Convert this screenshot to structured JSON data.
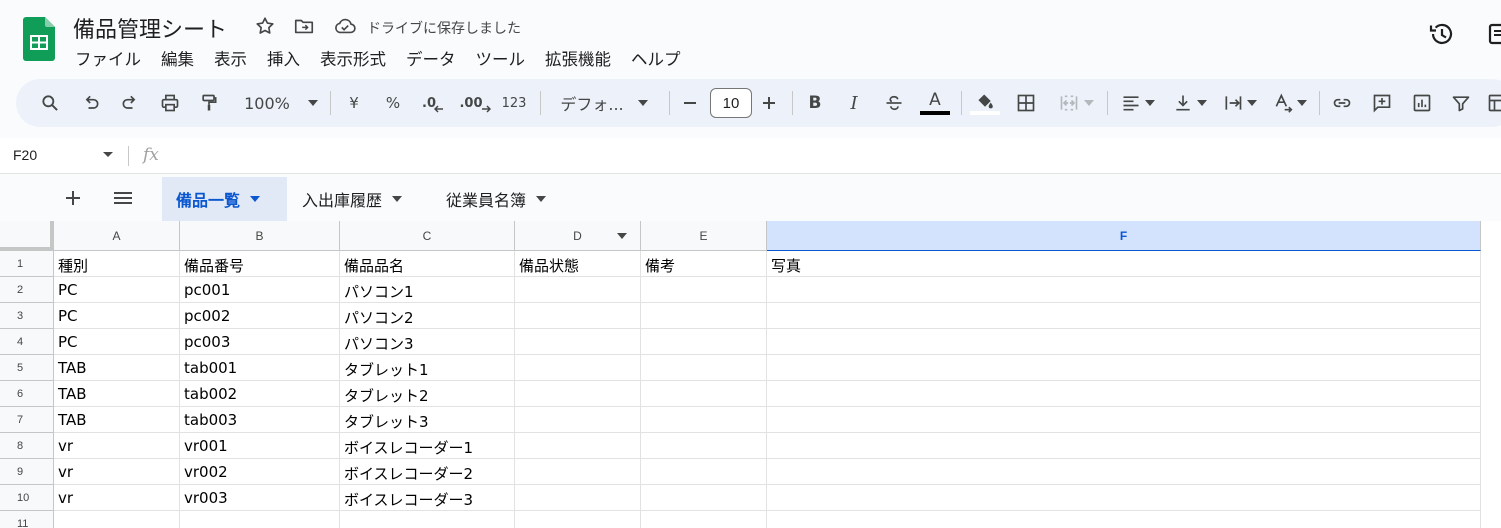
{
  "document": {
    "title": "備品管理シート",
    "saved_status": "ドライブに保存しました"
  },
  "menu": [
    "ファイル",
    "編集",
    "表示",
    "挿入",
    "表示形式",
    "データ",
    "ツール",
    "拡張機能",
    "ヘルプ"
  ],
  "toolbar": {
    "zoom": "100%",
    "currency": "¥",
    "percent": "%",
    "decrease_decimal": ".0",
    "increase_decimal": ".00",
    "number_format": "123",
    "font": "デフォ...",
    "font_size": "10",
    "bold": "B",
    "italic": "I",
    "text_color_glyph": "A",
    "text_color": "#000000",
    "fill_color": "#ffffff"
  },
  "formula_bar": {
    "name_box": "F20",
    "fx": "fx"
  },
  "sheets": [
    {
      "name": "備品一覧",
      "active": true
    },
    {
      "name": "入出庫履歴",
      "active": false
    },
    {
      "name": "従業員名簿",
      "active": false
    }
  ],
  "grid": {
    "selected_column": "F",
    "columns": [
      "A",
      "B",
      "C",
      "D",
      "E",
      "F"
    ],
    "row_numbers": [
      "1",
      "2",
      "3",
      "4",
      "5",
      "6",
      "7",
      "8",
      "9",
      "10",
      "11"
    ],
    "rows": [
      [
        "種別",
        "備品番号",
        "備品品名",
        "備品状態",
        "備考",
        "写真"
      ],
      [
        "PC",
        "pc001",
        "パソコン1",
        "",
        "",
        ""
      ],
      [
        "PC",
        "pc002",
        "パソコン2",
        "",
        "",
        ""
      ],
      [
        "PC",
        "pc003",
        "パソコン3",
        "",
        "",
        ""
      ],
      [
        "TAB",
        "tab001",
        "タブレット1",
        "",
        "",
        ""
      ],
      [
        "TAB",
        "tab002",
        "タブレット2",
        "",
        "",
        ""
      ],
      [
        "TAB",
        "tab003",
        "タブレット3",
        "",
        "",
        ""
      ],
      [
        "vr",
        "vr001",
        "ボイスレコーダー1",
        "",
        "",
        ""
      ],
      [
        "vr",
        "vr002",
        "ボイスレコーダー2",
        "",
        "",
        ""
      ],
      [
        "vr",
        "vr003",
        "ボイスレコーダー3",
        "",
        "",
        ""
      ],
      [
        "",
        "",
        "",
        "",
        "",
        ""
      ]
    ]
  },
  "colors": {
    "brand_green": "#0f9d58",
    "accent_blue": "#0b57d0",
    "selected_column_bg": "#d3e3fd",
    "toolbar_bg": "#edf2fa"
  }
}
